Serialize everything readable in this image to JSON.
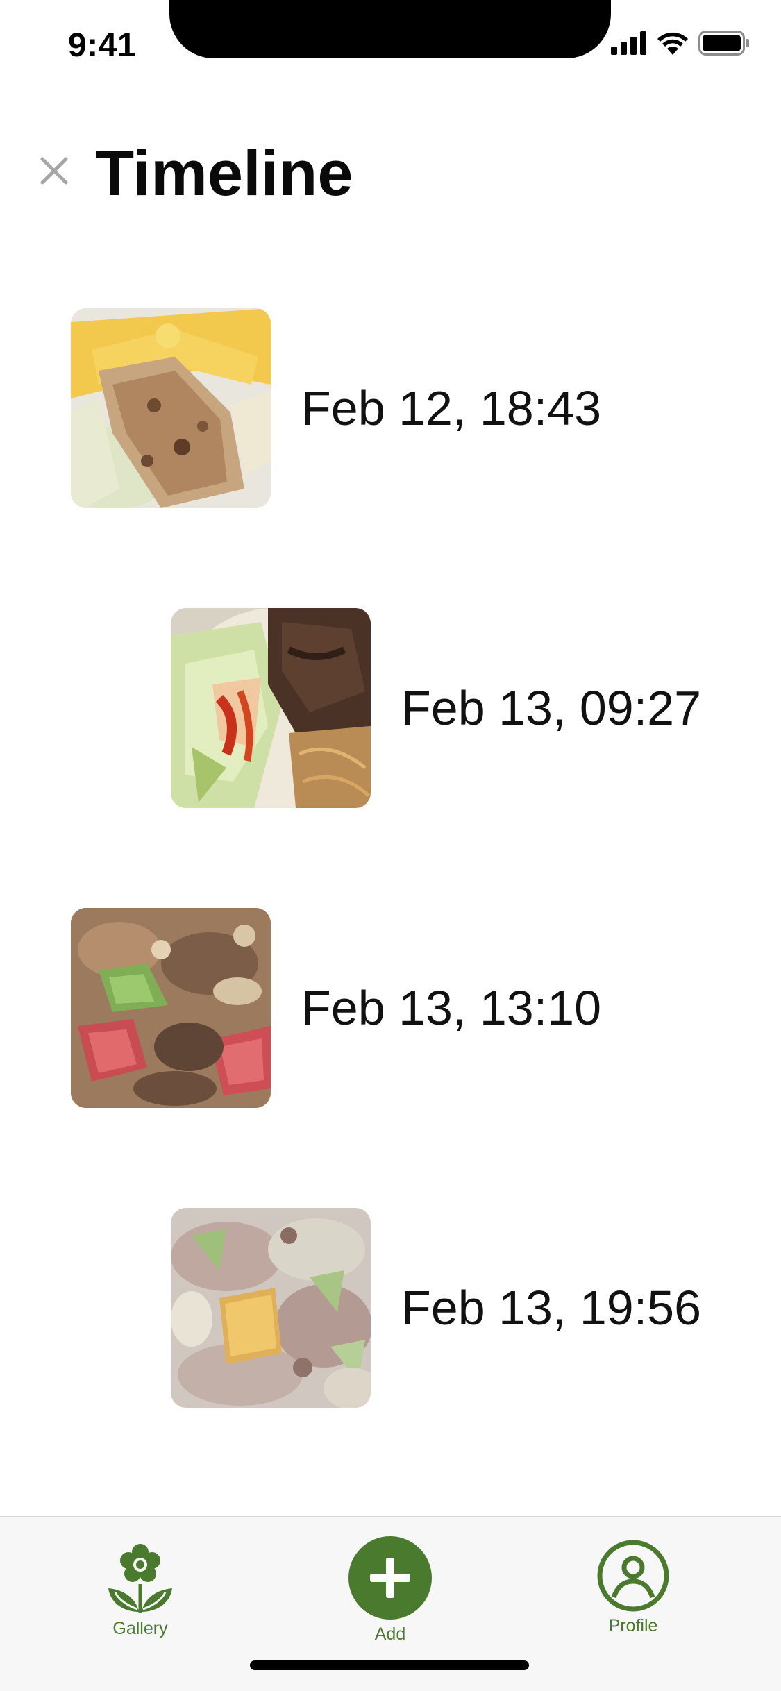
{
  "status_bar": {
    "time": "9:41"
  },
  "header": {
    "title": "Timeline",
    "close_icon": "close-icon"
  },
  "entries": [
    {
      "date": "Feb 12, 18:43",
      "photo": "scallion-pancake-egg-cabbage"
    },
    {
      "date": "Feb 13, 09:27",
      "photo": "beef-salad-glass-noodles"
    },
    {
      "date": "Feb 13, 13:10",
      "photo": "beef-hotpot"
    },
    {
      "date": "Feb 13, 19:56",
      "photo": "pork-tofu-cabbage-soup"
    }
  ],
  "tabbar": {
    "gallery_label": "Gallery",
    "add_label": "Add",
    "profile_label": "Profile"
  },
  "colors": {
    "accent": "#4a7a2e",
    "tabbar_background": "#f7f7f7",
    "title": "#0a0a0a"
  }
}
